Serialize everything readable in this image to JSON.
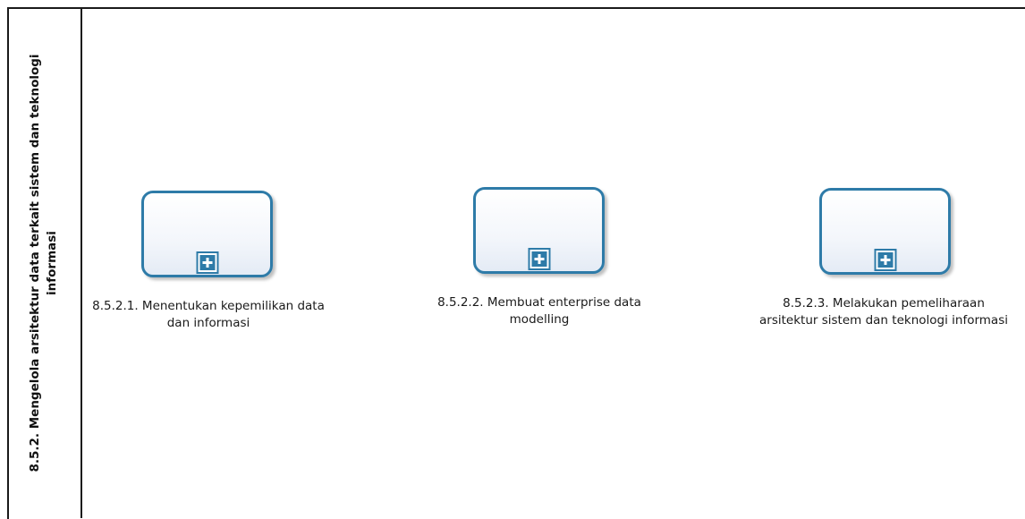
{
  "lane": {
    "title": "8.5.2. Mengelola arsitektur data terkait sistem dan teknologi informasi"
  },
  "tasks": [
    {
      "label": "8.5.2.1. Menentukan kepemilikan data dan informasi",
      "marker_icon": "collapsed-subprocess-plus-icon"
    },
    {
      "label": "8.5.2.2. Membuat enterprise data modelling",
      "marker_icon": "collapsed-subprocess-plus-icon"
    },
    {
      "label": "8.5.2.3. Melakukan pemeliharaan arsitektur sistem dan teknologi informasi",
      "marker_icon": "collapsed-subprocess-plus-icon"
    }
  ],
  "colors": {
    "task_border": "#2e7ba8",
    "pool_border": "#1a1a1a"
  }
}
